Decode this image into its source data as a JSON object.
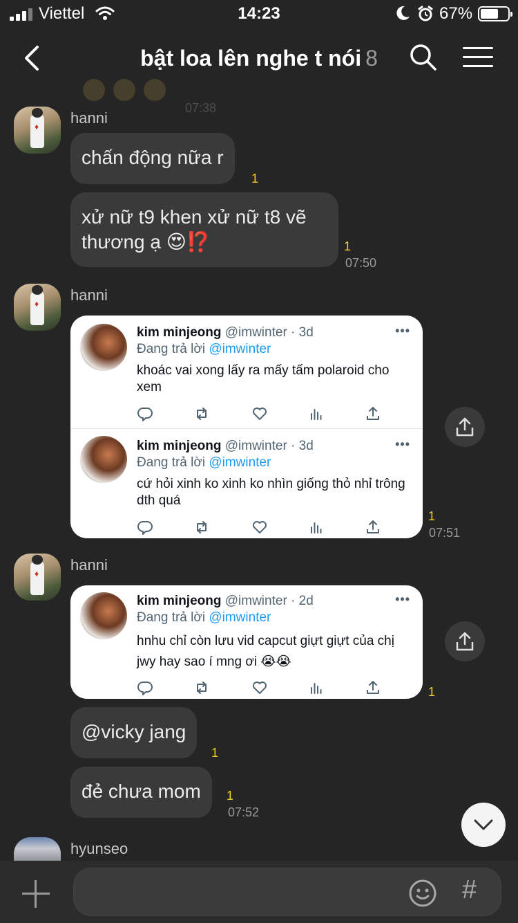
{
  "status_bar": {
    "carrier": "Viettel",
    "time": "14:23",
    "battery": "67%",
    "battery_level": 0.67
  },
  "header": {
    "title": "bật loa lên nghe t nói",
    "member_count": "8",
    "ghost_time": "07:38"
  },
  "messages": [
    {
      "sender": "hanni",
      "bubbles": [
        {
          "text": "chấn động nữa r",
          "unread": "1"
        },
        {
          "text_line1": "xử nữ t9 khen xử nữ t8 vẽ",
          "text_line2": "thương ạ 😍⁉️",
          "unread": "1",
          "time": "07:50"
        }
      ]
    },
    {
      "sender": "hanni",
      "unread": "1",
      "time": "07:51",
      "tweets": [
        {
          "name": "kim minjeong",
          "handle": "@imwinter · 3d",
          "reply_prefix": "Đang trả lời",
          "reply_handle": "@imwinter",
          "text": "khoác vai xong lấy ra mấy tấm polaroid cho xem"
        },
        {
          "name": "kim minjeong",
          "handle": "@imwinter · 3d",
          "reply_prefix": "Đang trả lời",
          "reply_handle": "@imwinter",
          "text": "cứ hỏi xinh ko xinh ko nhìn giống thỏ nhỉ trông dth quá"
        }
      ]
    },
    {
      "sender": "hanni",
      "unread": "1",
      "tweet": {
        "name": "kim minjeong",
        "handle": "@imwinter · 2d",
        "reply_prefix": "Đang trả lời",
        "reply_handle": "@imwinter",
        "text": "hnhu chỉ còn lưu vid capcut giựt giựt của chị jwy hay sao í mng ơi 😭😭"
      },
      "bubbles": [
        {
          "text": "@vicky jang",
          "unread": "1"
        },
        {
          "text": "đẻ chưa mom",
          "unread": "1",
          "time": "07:52"
        }
      ]
    },
    {
      "sender": "hyunseo"
    }
  ],
  "input": {
    "placeholder": "",
    "hash_label": "#"
  },
  "icons": [
    "signal-icon",
    "wifi-icon",
    "moon-icon",
    "alarm-icon",
    "battery-icon",
    "back-arrow-icon",
    "search-icon",
    "menu-icon",
    "share-icon",
    "chevron-down-icon",
    "plus-icon",
    "emoji-icon",
    "hash-icon",
    "reply-icon",
    "retweet-icon",
    "heart-icon",
    "views-icon",
    "upload-icon"
  ],
  "colors": {
    "background": "#252525",
    "bubble": "#3a3a3a",
    "unread": "#f5d020",
    "link": "#1d9bf0"
  }
}
